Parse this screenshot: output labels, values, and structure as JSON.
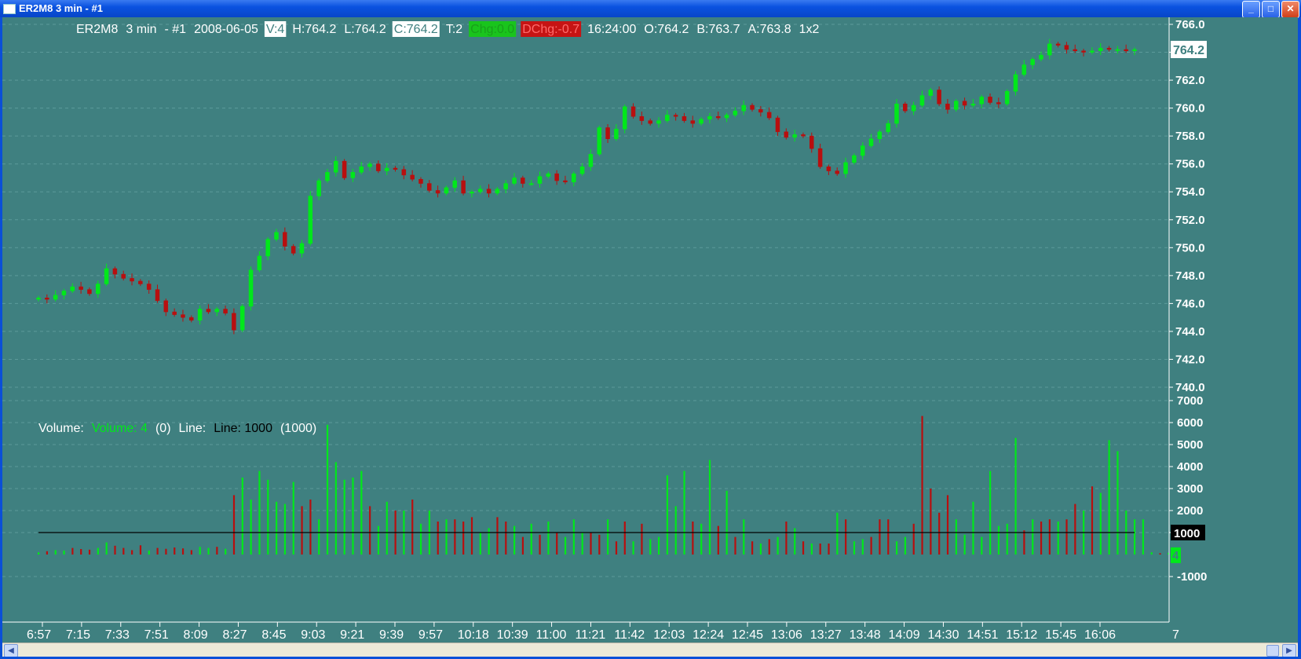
{
  "window": {
    "title": "ER2M8  3 min  - #1",
    "buttons": {
      "minimize": "_",
      "maximize": "□",
      "close": "✕"
    }
  },
  "header": {
    "symbol": "ER2M8",
    "interval": "3 min",
    "chart_id": "- #1",
    "date": "2008-06-05",
    "volume": "V:4",
    "high": "H:764.2",
    "low": "L:764.2",
    "close": "C:764.2",
    "trades": "T:2",
    "change": "Chg:0.0",
    "daily_change": "DChg:-0.7",
    "time": "16:24:00",
    "open": "O:764.2",
    "bid": "B:763.7",
    "ask": "A:763.8",
    "size": "1x2"
  },
  "volume_header": {
    "label": "Volume:",
    "value_label": "Volume: 4",
    "value_paren": "(0)",
    "line_label": "Line:",
    "line_value_label": "Line: 1000",
    "line_paren": "(1000)"
  },
  "colors": {
    "background": "#3f8080",
    "up": "#00e81a",
    "down": "#b80f0f",
    "text": "#ffffff",
    "grid": "#5c9a9a",
    "line": "#000000"
  },
  "chart_data": [
    {
      "type": "candlestick",
      "name": "price",
      "ylim": [
        740.0,
        766.0
      ],
      "y_ticks": [
        "766.0",
        "764.0",
        "762.0",
        "760.0",
        "758.0",
        "756.0",
        "754.0",
        "752.0",
        "750.0",
        "748.0",
        "746.0",
        "744.0",
        "742.0",
        "740.0"
      ],
      "last_price_label": "764.2",
      "x_tick_labels": [
        "6:57",
        "7:15",
        "7:33",
        "7:51",
        "8:09",
        "8:27",
        "8:45",
        "9:03",
        "9:21",
        "9:39",
        "9:57",
        "10:18",
        "10:39",
        "11:00",
        "11:21",
        "11:42",
        "12:03",
        "12:24",
        "12:45",
        "13:06",
        "13:27",
        "13:48",
        "14:09",
        "14:30",
        "14:51",
        "15:12",
        "15:45",
        "16:06"
      ],
      "x_axis_right_label": "7",
      "grid": true,
      "closes": [
        746.4,
        746.3,
        746.6,
        746.9,
        747.2,
        747.0,
        746.7,
        747.4,
        748.5,
        748.1,
        747.8,
        747.6,
        747.4,
        747.0,
        746.2,
        745.4,
        745.2,
        745.0,
        744.8,
        745.6,
        745.4,
        745.6,
        745.3,
        744.1,
        745.8,
        748.4,
        749.4,
        750.6,
        751.1,
        750.1,
        749.6,
        750.3,
        753.7,
        754.8,
        755.4,
        756.2,
        755.0,
        755.4,
        755.8,
        756.0,
        755.5,
        755.7,
        755.6,
        755.2,
        754.9,
        754.6,
        754.1,
        753.9,
        754.3,
        754.8,
        753.9,
        754.0,
        754.2,
        753.9,
        754.2,
        754.6,
        755.0,
        754.6,
        754.6,
        755.1,
        755.3,
        754.8,
        754.7,
        755.3,
        755.8,
        756.7,
        758.6,
        757.8,
        758.5,
        760.1,
        759.4,
        759.1,
        758.9,
        759.1,
        759.5,
        759.4,
        759.1,
        758.9,
        759.2,
        759.4,
        759.3,
        759.5,
        759.8,
        760.2,
        759.9,
        759.7,
        759.3,
        758.3,
        757.9,
        758.1,
        758.0,
        757.1,
        755.8,
        755.5,
        755.3,
        756.1,
        756.6,
        757.3,
        757.8,
        758.3,
        758.9,
        760.3,
        759.8,
        760.2,
        760.9,
        761.3,
        760.3,
        759.9,
        760.5,
        760.2,
        760.3,
        760.8,
        760.4,
        760.3,
        761.2,
        762.4,
        763.1,
        763.5,
        763.8,
        764.6,
        764.5,
        764.2,
        764.1,
        764.0,
        764.1,
        764.3,
        764.2,
        764.2,
        764.1,
        764.2
      ],
      "volumes": [
        {
          "v": 100,
          "d": 1
        },
        {
          "v": 150,
          "d": 0
        },
        {
          "v": 200,
          "d": 1
        },
        {
          "v": 180,
          "d": 1
        },
        {
          "v": 300,
          "d": 0
        },
        {
          "v": 250,
          "d": 0
        },
        {
          "v": 220,
          "d": 0
        },
        {
          "v": 300,
          "d": 1
        },
        {
          "v": 550,
          "d": 1
        },
        {
          "v": 400,
          "d": 0
        },
        {
          "v": 300,
          "d": 0
        },
        {
          "v": 200,
          "d": 0
        },
        {
          "v": 420,
          "d": 0
        },
        {
          "v": 180,
          "d": 1
        },
        {
          "v": 300,
          "d": 0
        },
        {
          "v": 260,
          "d": 0
        },
        {
          "v": 320,
          "d": 0
        },
        {
          "v": 280,
          "d": 0
        },
        {
          "v": 200,
          "d": 0
        },
        {
          "v": 350,
          "d": 1
        },
        {
          "v": 300,
          "d": 1
        },
        {
          "v": 350,
          "d": 0
        },
        {
          "v": 260,
          "d": 1
        },
        {
          "v": 2700,
          "d": 0
        },
        {
          "v": 3500,
          "d": 1
        },
        {
          "v": 2500,
          "d": 1
        },
        {
          "v": 3800,
          "d": 1
        },
        {
          "v": 3400,
          "d": 1
        },
        {
          "v": 2400,
          "d": 1
        },
        {
          "v": 2300,
          "d": 1
        },
        {
          "v": 3300,
          "d": 1
        },
        {
          "v": 2200,
          "d": 0
        },
        {
          "v": 2500,
          "d": 0
        },
        {
          "v": 1600,
          "d": 1
        },
        {
          "v": 5900,
          "d": 1
        },
        {
          "v": 4200,
          "d": 1
        },
        {
          "v": 3400,
          "d": 1
        },
        {
          "v": 3500,
          "d": 1
        },
        {
          "v": 3800,
          "d": 1
        },
        {
          "v": 2200,
          "d": 0
        },
        {
          "v": 1300,
          "d": 1
        },
        {
          "v": 2400,
          "d": 1
        },
        {
          "v": 2000,
          "d": 0
        },
        {
          "v": 2000,
          "d": 1
        },
        {
          "v": 2500,
          "d": 0
        },
        {
          "v": 1400,
          "d": 1
        },
        {
          "v": 2000,
          "d": 1
        },
        {
          "v": 1500,
          "d": 0
        },
        {
          "v": 1600,
          "d": 1
        },
        {
          "v": 1600,
          "d": 0
        },
        {
          "v": 1500,
          "d": 0
        },
        {
          "v": 1700,
          "d": 0
        },
        {
          "v": 1000,
          "d": 1
        },
        {
          "v": 1200,
          "d": 1
        },
        {
          "v": 1700,
          "d": 0
        },
        {
          "v": 1500,
          "d": 0
        },
        {
          "v": 1300,
          "d": 1
        },
        {
          "v": 800,
          "d": 0
        },
        {
          "v": 1400,
          "d": 1
        },
        {
          "v": 900,
          "d": 0
        },
        {
          "v": 1500,
          "d": 1
        },
        {
          "v": 1000,
          "d": 0
        },
        {
          "v": 800,
          "d": 1
        },
        {
          "v": 1600,
          "d": 1
        },
        {
          "v": 1000,
          "d": 1
        },
        {
          "v": 1000,
          "d": 0
        },
        {
          "v": 900,
          "d": 0
        },
        {
          "v": 1600,
          "d": 1
        },
        {
          "v": 600,
          "d": 0
        },
        {
          "v": 1500,
          "d": 0
        },
        {
          "v": 600,
          "d": 1
        },
        {
          "v": 1400,
          "d": 0
        },
        {
          "v": 700,
          "d": 1
        },
        {
          "v": 800,
          "d": 1
        },
        {
          "v": 3600,
          "d": 1
        },
        {
          "v": 2200,
          "d": 1
        },
        {
          "v": 3800,
          "d": 1
        },
        {
          "v": 1500,
          "d": 0
        },
        {
          "v": 1400,
          "d": 1
        },
        {
          "v": 4300,
          "d": 1
        },
        {
          "v": 1300,
          "d": 0
        },
        {
          "v": 2900,
          "d": 1
        },
        {
          "v": 800,
          "d": 0
        },
        {
          "v": 1600,
          "d": 1
        },
        {
          "v": 600,
          "d": 0
        },
        {
          "v": 500,
          "d": 1
        },
        {
          "v": 700,
          "d": 0
        },
        {
          "v": 800,
          "d": 1
        },
        {
          "v": 1500,
          "d": 0
        },
        {
          "v": 1200,
          "d": 1
        },
        {
          "v": 600,
          "d": 0
        },
        {
          "v": 500,
          "d": 1
        },
        {
          "v": 500,
          "d": 0
        },
        {
          "v": 500,
          "d": 0
        },
        {
          "v": 1900,
          "d": 1
        },
        {
          "v": 1600,
          "d": 0
        },
        {
          "v": 600,
          "d": 1
        },
        {
          "v": 700,
          "d": 1
        },
        {
          "v": 800,
          "d": 0
        },
        {
          "v": 1600,
          "d": 0
        },
        {
          "v": 1600,
          "d": 0
        },
        {
          "v": 600,
          "d": 1
        },
        {
          "v": 800,
          "d": 1
        },
        {
          "v": 1400,
          "d": 0
        },
        {
          "v": 6300,
          "d": 0
        },
        {
          "v": 3000,
          "d": 0
        },
        {
          "v": 1900,
          "d": 0
        },
        {
          "v": 2700,
          "d": 0
        },
        {
          "v": 1600,
          "d": 1
        },
        {
          "v": 900,
          "d": 1
        },
        {
          "v": 2400,
          "d": 1
        },
        {
          "v": 800,
          "d": 1
        },
        {
          "v": 3800,
          "d": 1
        },
        {
          "v": 1300,
          "d": 1
        },
        {
          "v": 1400,
          "d": 1
        },
        {
          "v": 5300,
          "d": 1
        },
        {
          "v": 1100,
          "d": 0
        },
        {
          "v": 1600,
          "d": 1
        },
        {
          "v": 1500,
          "d": 0
        },
        {
          "v": 1600,
          "d": 0
        },
        {
          "v": 1500,
          "d": 1
        },
        {
          "v": 1600,
          "d": 0
        },
        {
          "v": 2300,
          "d": 0
        },
        {
          "v": 2000,
          "d": 1
        },
        {
          "v": 3100,
          "d": 0
        },
        {
          "v": 2800,
          "d": 1
        },
        {
          "v": 5200,
          "d": 1
        },
        {
          "v": 4700,
          "d": 1
        },
        {
          "v": 2000,
          "d": 1
        },
        {
          "v": 1600,
          "d": 1
        },
        {
          "v": 1600,
          "d": 1
        },
        {
          "v": 100,
          "d": 1
        },
        {
          "v": 60,
          "d": 0
        },
        {
          "v": 80,
          "d": 1
        }
      ],
      "volume_ylim": [
        -1000,
        7000
      ],
      "volume_y_ticks": [
        "7000",
        "6000",
        "5000",
        "4000",
        "3000",
        "2000",
        "1000",
        "-1000"
      ],
      "volume_last_label": "4",
      "line_level": 1000,
      "line_level_label": "1000"
    }
  ]
}
